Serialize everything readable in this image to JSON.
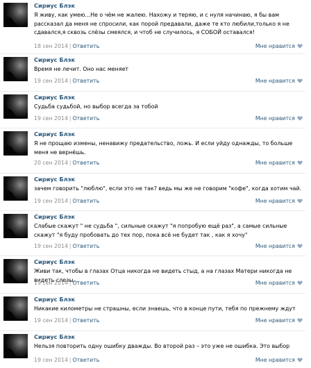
{
  "comments": [
    {
      "author": "Сириус Блэк",
      "text": "Я живу, как умею...Не о чём не жалею. Нахожу и теряю, и с нуля начинаю, я бы вам рассказал да меня не спросили, как порой предавали, даже те кто любили,только я не сдавался,я сквозь слёзы смеялся, и чтоб не случилось, я СОБОЙ оставался!",
      "date": "18 сен 2014",
      "reply": "Ответить",
      "like": "Мне нравится"
    },
    {
      "author": "Сириус Блэк",
      "text": "Время не лечит. Оно нас меняет",
      "date": "19 сен 2014",
      "reply": "Ответить",
      "like": "Мне нравится"
    },
    {
      "author": "Сириус Блэк",
      "text": "Судьба судьбой, но выбор всегда за тобой",
      "date": "19 сен 2014",
      "reply": "Ответить",
      "like": "Мне нравится"
    },
    {
      "author": "Сириус Блэк",
      "text": "Я не прощаю измены, ненавижу предательство, ложь. И если уйду однажды, то больше меня не вернёшь.",
      "date": "20 сен 2014",
      "reply": "Ответить",
      "like": "Мне нравится"
    },
    {
      "author": "Сириус Блэк",
      "text": "зачем говорить \"люблю\", если это не так? ведь мы же не говорим \"кофе\", когда хотим чай.",
      "date": "19 сен 2014",
      "reply": "Ответить",
      "like": "Мне нравится"
    },
    {
      "author": "Сириус Блэк",
      "text": "Слабые скажут \" не судьба \", сильные скажут \"я попробую ещё раз\", а самые сильные скажут \"я буду пробовать до тех пор, пока всё не будет так , как я хочу\"",
      "date": "19 сен 2014",
      "reply": "Ответить",
      "like": "Мне нравится"
    },
    {
      "author": "Сириус Блэк",
      "text": "Живи так, чтобы в глазах Отца никогда не видеть стыд, а на глазах Матери никогда не видеть слезы...",
      "date": "19 сен 2014",
      "reply": "Ответить",
      "like": "Мне нравится"
    },
    {
      "author": "Сириус Блэк",
      "text": "Никакие километры не страшны, если знаешь, что в конце пути, тебя по прежнему ждут",
      "date": "19 сен 2014",
      "reply": "Ответить",
      "like": "Мне нравится"
    },
    {
      "author": "Сириус Блэк",
      "text": "Нельзя повторить одну ошибку дважды. Во второй раз – это уже не ошибка. Это выбор",
      "date": "19 сен 2014",
      "reply": "Ответить",
      "like": "Мне нравится"
    }
  ],
  "colors": {
    "link": "#2b587a",
    "meta": "#8a8a8a",
    "divider": "#e7eaed"
  },
  "icons": {
    "avatar": "avatar-photo",
    "like": "heart-icon"
  }
}
